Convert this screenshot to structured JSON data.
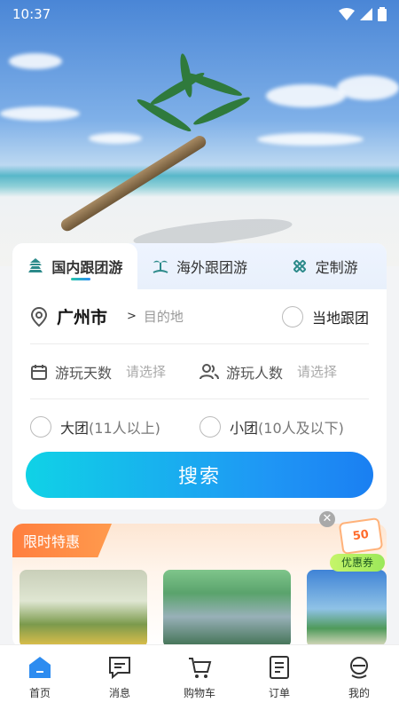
{
  "status_bar": {
    "time": "10:37"
  },
  "tabs": [
    {
      "label": "国内跟团游",
      "icon": "pagoda-icon",
      "active": true
    },
    {
      "label": "海外跟团游",
      "icon": "island-icon",
      "active": false
    },
    {
      "label": "定制游",
      "icon": "tools-icon",
      "active": false
    }
  ],
  "search": {
    "departure_city": "广州市",
    "arrow": ">",
    "destination_placeholder": "目的地",
    "local_group_label": "当地跟团",
    "days_label": "游玩天数",
    "days_value": "请选择",
    "people_label": "游玩人数",
    "people_value": "请选择",
    "large_group": {
      "name": "大团",
      "note": "(11人以上)"
    },
    "small_group": {
      "name": "小团",
      "note": "(10人及以下)"
    },
    "button_label": "搜索"
  },
  "promo": {
    "title": "限时特惠",
    "coupon_value": "50",
    "coupon_label": "优惠券",
    "close_symbol": "✕"
  },
  "bottom_nav": [
    {
      "label": "首页",
      "icon": "home-icon",
      "active": true
    },
    {
      "label": "消息",
      "icon": "message-icon",
      "active": false
    },
    {
      "label": "购物车",
      "icon": "cart-icon",
      "active": false
    },
    {
      "label": "订单",
      "icon": "order-icon",
      "active": false
    },
    {
      "label": "我的",
      "icon": "profile-icon",
      "active": false
    }
  ],
  "colors": {
    "accent": "#1f96f5",
    "promo": "#ff8a3d"
  }
}
